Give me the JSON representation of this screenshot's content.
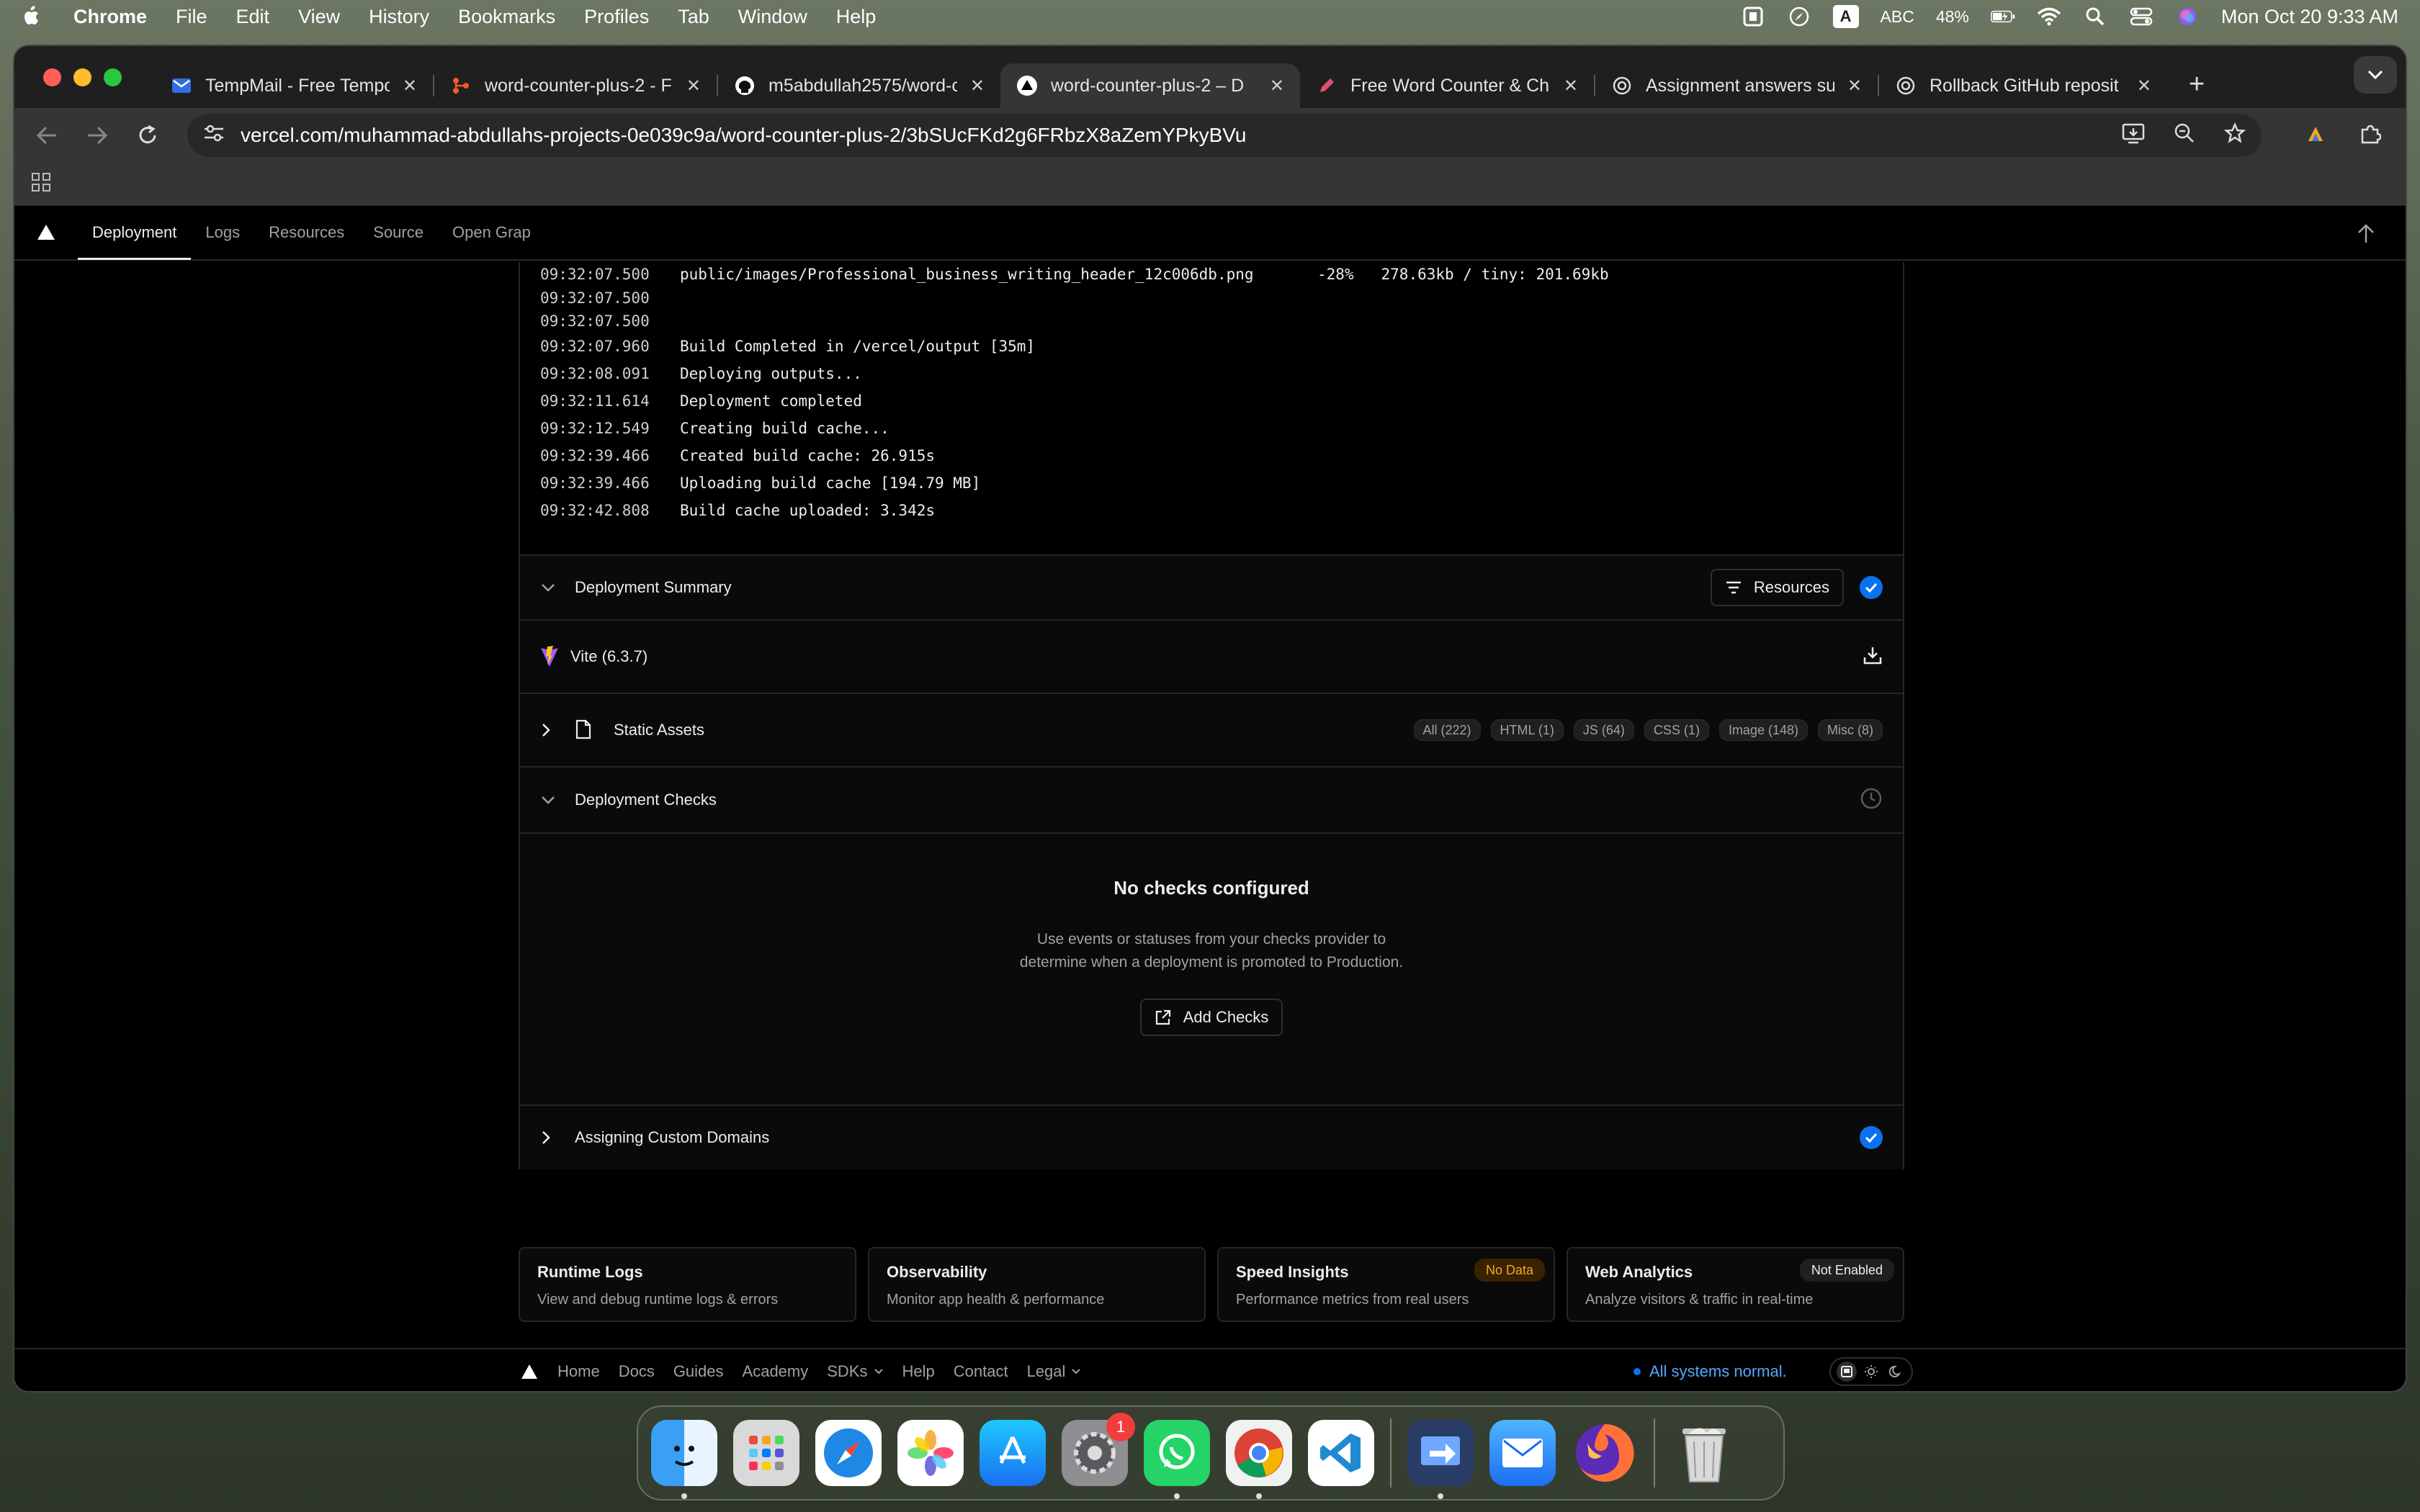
{
  "menubar": {
    "app_name": "Chrome",
    "items": [
      "File",
      "Edit",
      "View",
      "History",
      "Bookmarks",
      "Profiles",
      "Tab",
      "Window",
      "Help"
    ],
    "input_label": "A",
    "input_source": "ABC",
    "battery": "48%",
    "datetime": "Mon Oct 20  9:33 AM"
  },
  "tabs": [
    {
      "title": "TempMail - Free Tempor",
      "icon": "mail-icon"
    },
    {
      "title": "word-counter-plus-2 - F",
      "icon": "git-icon"
    },
    {
      "title": "m5abdullah2575/word-c",
      "icon": "github-icon"
    },
    {
      "title": "word-counter-plus-2 – D",
      "icon": "vercel-icon"
    },
    {
      "title": "Free Word Counter & Ch",
      "icon": "pen-icon"
    },
    {
      "title": "Assignment answers su",
      "icon": "openai-icon"
    },
    {
      "title": "Rollback GitHub reposit",
      "icon": "openai-icon"
    }
  ],
  "address_bar": {
    "url": "vercel.com/muhammad-abdullahs-projects-0e039c9a/word-counter-plus-2/3bSUcFKd2g6FRbzX8aZemYPkyBVu"
  },
  "vercel_nav": {
    "tabs": [
      "Deployment",
      "Logs",
      "Resources",
      "Source",
      "Open Grap"
    ]
  },
  "build_logs": [
    {
      "time": "09:32:07.500",
      "message": "public/images/Professional_business_writing_header_12c006db.png       -28%   278.63kb / tiny: 201.69kb"
    },
    {
      "time": "09:32:07.500",
      "message": ""
    },
    {
      "time": "09:32:07.500",
      "message": ""
    },
    {
      "time": "09:32:07.960",
      "message": "Build Completed in /vercel/output [35m]"
    },
    {
      "time": "09:32:08.091",
      "message": "Deploying outputs..."
    },
    {
      "time": "09:32:11.614",
      "message": "Deployment completed"
    },
    {
      "time": "09:32:12.549",
      "message": "Creating build cache..."
    },
    {
      "time": "09:32:39.466",
      "message": "Created build cache: 26.915s"
    },
    {
      "time": "09:32:39.466",
      "message": "Uploading build cache [194.79 MB]"
    },
    {
      "time": "09:32:42.808",
      "message": "Build cache uploaded: 3.342s"
    }
  ],
  "summary": {
    "title": "Deployment Summary",
    "resources_label": "Resources",
    "framework": "Vite (6.3.7)",
    "static_assets_label": "Static Assets",
    "asset_filters": [
      "All (222)",
      "HTML (1)",
      "JS (64)",
      "CSS (1)",
      "Image (148)",
      "Misc (8)"
    ]
  },
  "checks": {
    "title": "Deployment Checks",
    "empty_title": "No checks configured",
    "empty_desc": "Use events or statuses from your checks provider to determine when a deployment is promoted to Production.",
    "add_label": "Add Checks"
  },
  "domains": {
    "title": "Assigning Custom Domains"
  },
  "cards": [
    {
      "title": "Runtime Logs",
      "desc": "View and debug runtime logs & errors",
      "badge": ""
    },
    {
      "title": "Observability",
      "desc": "Monitor app health & performance",
      "badge": ""
    },
    {
      "title": "Speed Insights",
      "desc": "Performance metrics from real users",
      "badge": "No Data"
    },
    {
      "title": "Web Analytics",
      "desc": "Analyze visitors & traffic in real-time",
      "badge": "Not Enabled"
    }
  ],
  "footer": {
    "links": [
      "Home",
      "Docs",
      "Guides",
      "Academy",
      "SDKs",
      "Help",
      "Contact",
      "Legal"
    ],
    "status": "All systems normal."
  },
  "dock": {
    "settings_badge": "1"
  },
  "colors": {
    "accent_blue": "#0a72ef",
    "badge_orange": "#f5a623"
  }
}
